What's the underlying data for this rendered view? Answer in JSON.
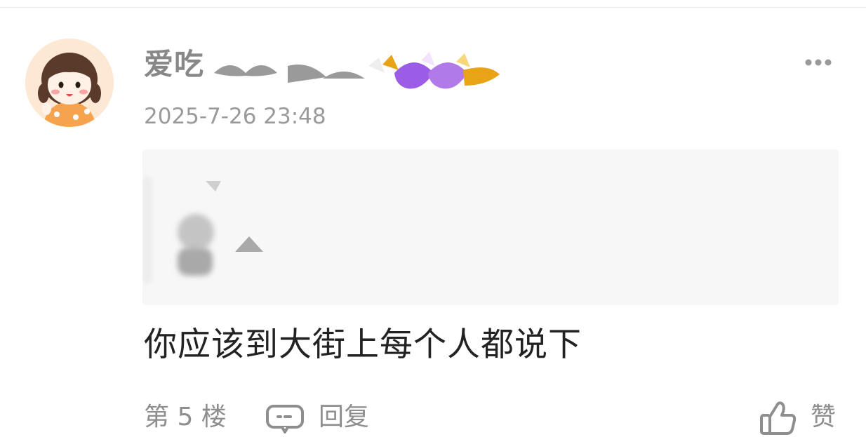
{
  "comment": {
    "username_visible": "爱吃",
    "timestamp": "2025-7-26 23:48",
    "text": "你应该到大街上每个人都说下",
    "floor": "第 5 楼",
    "reply_label": "回复",
    "like_label": "赞"
  },
  "icons": {
    "avatar": "cartoon-girl-avatar",
    "more": "more-dots-icon",
    "reply": "reply-bubble-icon",
    "like": "thumbs-up-icon"
  },
  "colors": {
    "muted_text": "#8e8e8e",
    "body_text": "#222222",
    "quote_background": "#f7f7f7",
    "badge_purple": "#9b5de5",
    "badge_gold": "#e8a317"
  }
}
